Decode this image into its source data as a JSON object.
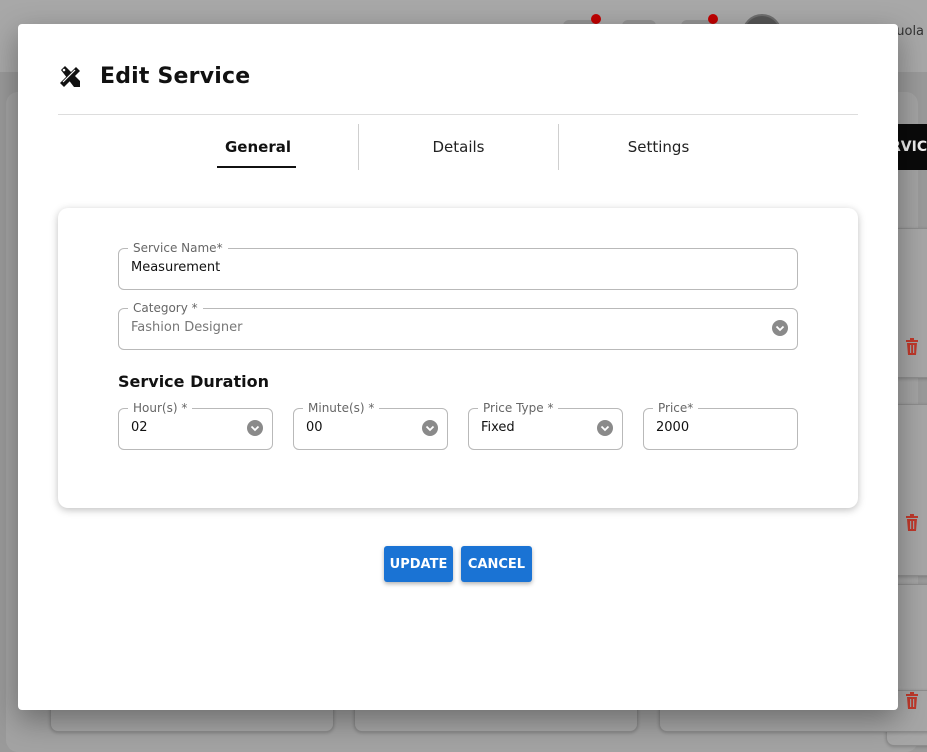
{
  "background": {
    "username_fragment": "puola",
    "service_button_fragment": "RVIC"
  },
  "modal": {
    "title": "Edit Service",
    "title_icon": "design-tools-icon"
  },
  "tabs": [
    {
      "label": "General",
      "active": true
    },
    {
      "label": "Details",
      "active": false
    },
    {
      "label": "Settings",
      "active": false
    }
  ],
  "form": {
    "service_name": {
      "label": "Service Name*",
      "value": "Measurement"
    },
    "category": {
      "label": "Category *",
      "value": "Fashion Designer"
    },
    "section_title": "Service Duration",
    "hours": {
      "label": "Hour(s) *",
      "value": "02"
    },
    "minutes": {
      "label": "Minute(s) *",
      "value": "00"
    },
    "price_type": {
      "label": "Price Type *",
      "value": "Fixed"
    },
    "price": {
      "label": "Price*",
      "value": "2000"
    }
  },
  "buttons": {
    "update": "UPDATE",
    "cancel": "CANCEL"
  },
  "colors": {
    "primary": "#1a73d4",
    "overlay": "#9a9a9a",
    "notification_dot": "#c00000",
    "delete_icon": "#c0392b"
  }
}
